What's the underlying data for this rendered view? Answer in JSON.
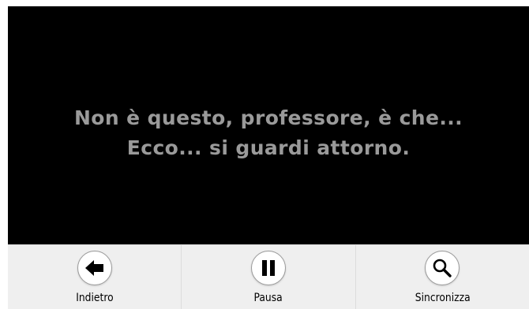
{
  "subtitles": {
    "line1": "Non è questo, professore, è che...",
    "line2": "Ecco... si guardi attorno."
  },
  "toolbar": {
    "back": {
      "label": "Indietro",
      "icon": "arrow-left-icon"
    },
    "pause": {
      "label": "Pausa",
      "icon": "pause-icon"
    },
    "sync": {
      "label": "Sincronizza",
      "icon": "search-icon"
    }
  },
  "colors": {
    "video_background": "#000000",
    "subtitle_text": "#9a9a9a",
    "toolbar_background": "#efefef"
  }
}
